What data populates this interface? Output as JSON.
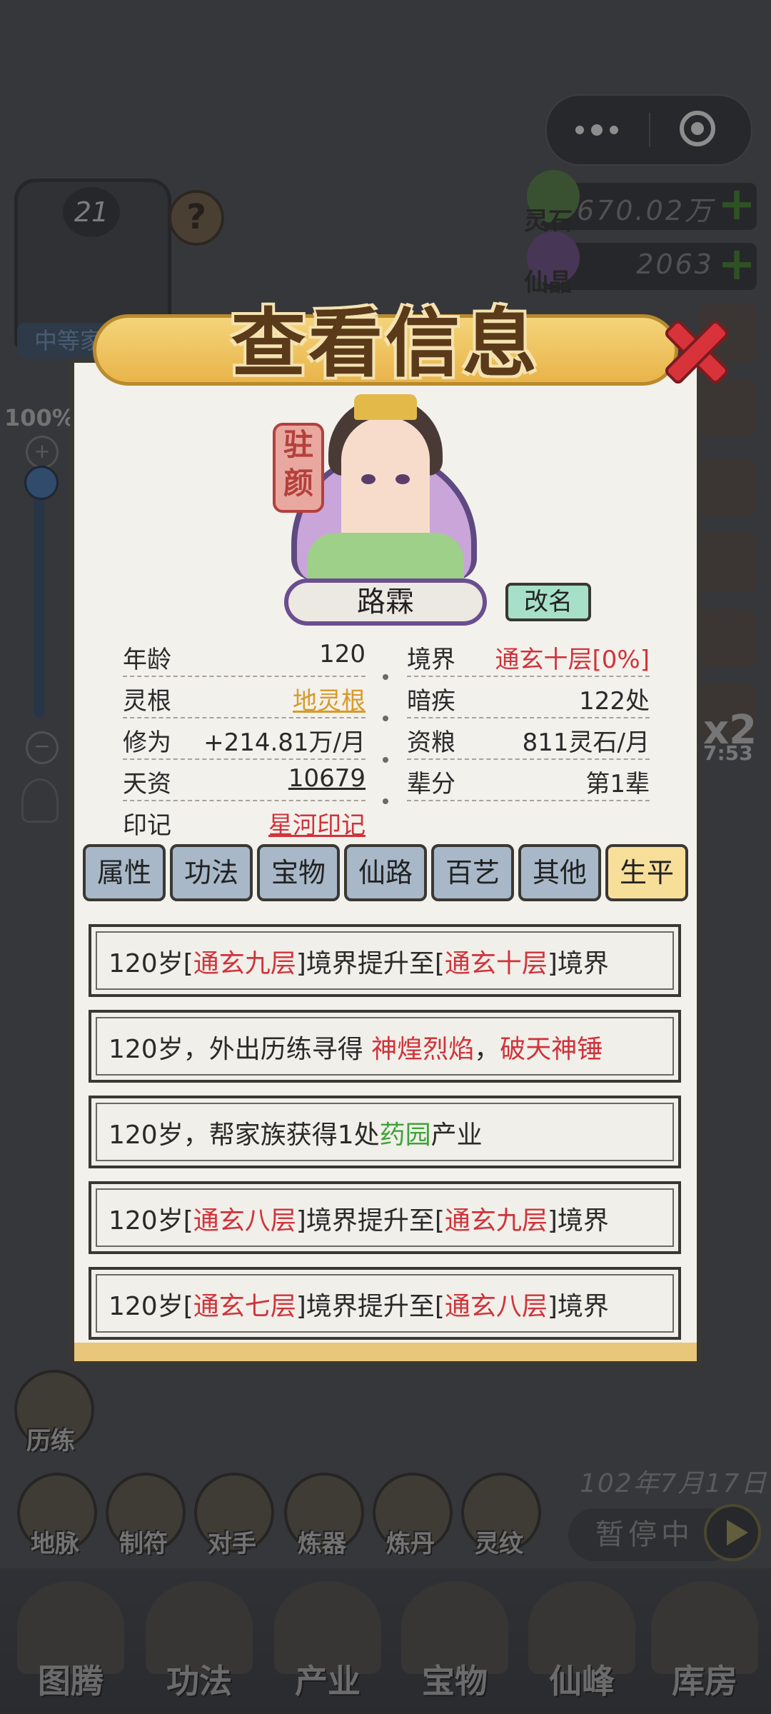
{
  "top_bar": {
    "more_icon": "more-dots-icon",
    "close_icon": "target-icon"
  },
  "player": {
    "level": "21",
    "title_chip": "中等家",
    "help_icon": "?"
  },
  "zoom": {
    "label": "100%",
    "plus": "+",
    "minus": "−",
    "level_fraction": 1.0
  },
  "resources": [
    {
      "label": "灵石",
      "value": "670.02万",
      "icon": "spirit-stone-icon"
    },
    {
      "label": "仙晶",
      "value": "2063",
      "icon": "crystal-icon"
    }
  ],
  "speed": {
    "label": "x2",
    "timer": "7:53"
  },
  "dialog": {
    "title": "查看信息",
    "seal_text": "驻颜",
    "name": "路霖",
    "rename_label": "改名",
    "stats_left": [
      {
        "label": "年龄",
        "value": "120"
      },
      {
        "label": "灵根",
        "value": "地灵根"
      },
      {
        "label": "修为",
        "value": "+214.81万/月"
      },
      {
        "label": "天资",
        "value": "10679"
      },
      {
        "label": "印记",
        "value": "星河印记"
      }
    ],
    "stats_right": [
      {
        "label": "境界",
        "value": "通玄十层[0%]"
      },
      {
        "label": "暗疾",
        "value": "122处"
      },
      {
        "label": "资粮",
        "value": "811灵石/月"
      },
      {
        "label": "辈分",
        "value": "第1辈"
      }
    ],
    "tabs": [
      "属性",
      "功法",
      "宝物",
      "仙路",
      "百艺",
      "其他",
      "生平"
    ],
    "active_tab": "生平",
    "events": [
      {
        "parts": [
          "120岁[",
          "通玄九层",
          "]境界提升至[",
          "通玄十层",
          "]境界"
        ]
      },
      {
        "parts": [
          "120岁，外出历练寻得 ",
          "神煌烈焰",
          "，",
          "破天神锤"
        ]
      },
      {
        "parts": [
          "120岁，帮家族获得1处",
          "药园",
          "产业"
        ]
      },
      {
        "parts": [
          "120岁[",
          "通玄八层",
          "]境界提升至[",
          "通玄九层",
          "]境界"
        ]
      },
      {
        "parts": [
          "120岁[",
          "通玄七层",
          "]境界提升至[",
          "通玄八层",
          "]境界"
        ]
      }
    ]
  },
  "bottom": {
    "train_label": "历练",
    "skills": [
      "地脉",
      "制符",
      "对手",
      "炼器",
      "炼丹",
      "灵纹"
    ],
    "date": "102年7月17日",
    "pause_label": "暂停中",
    "nav": [
      "图腾",
      "功法",
      "产业",
      "宝物",
      "仙峰",
      "库房"
    ]
  },
  "colors": {
    "accent_red": "#d0333b",
    "accent_gold": "#d89a2a",
    "accent_green": "#3ea33a",
    "tab_active": "#f7df9a",
    "tab_inactive": "#a8b8c8"
  }
}
